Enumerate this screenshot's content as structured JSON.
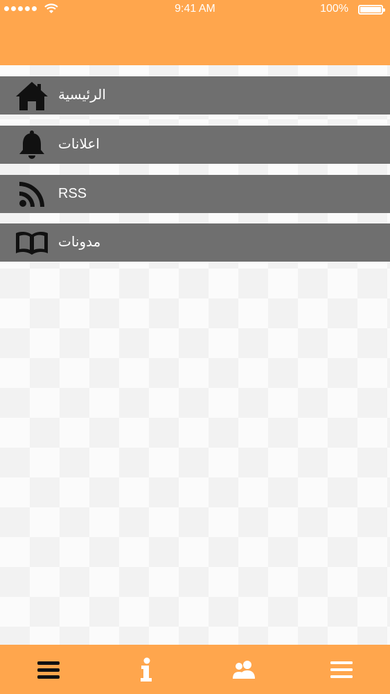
{
  "status_bar": {
    "signal_icon": "signal-dots-icon",
    "wifi_icon": "wifi-icon",
    "time": "9:41 AM",
    "battery_text": "100%",
    "battery_icon": "battery-icon",
    "battery_level": 1.0
  },
  "colors": {
    "accent": "#ffa64d",
    "menu_item_bg": "#6f6f6f",
    "menu_text": "#ffffff",
    "icon": "#111111"
  },
  "menu": {
    "items": [
      {
        "label": "الرئيسية",
        "icon": "home-icon"
      },
      {
        "label": "اعلانات",
        "icon": "bell-icon"
      },
      {
        "label": "RSS",
        "icon": "rss-icon"
      },
      {
        "label": "مدونات",
        "icon": "book-icon"
      }
    ]
  },
  "tabbar": {
    "tabs": [
      {
        "icon": "menu-icon"
      },
      {
        "icon": "info-icon"
      },
      {
        "icon": "users-icon"
      },
      {
        "icon": "list-icon"
      }
    ]
  }
}
